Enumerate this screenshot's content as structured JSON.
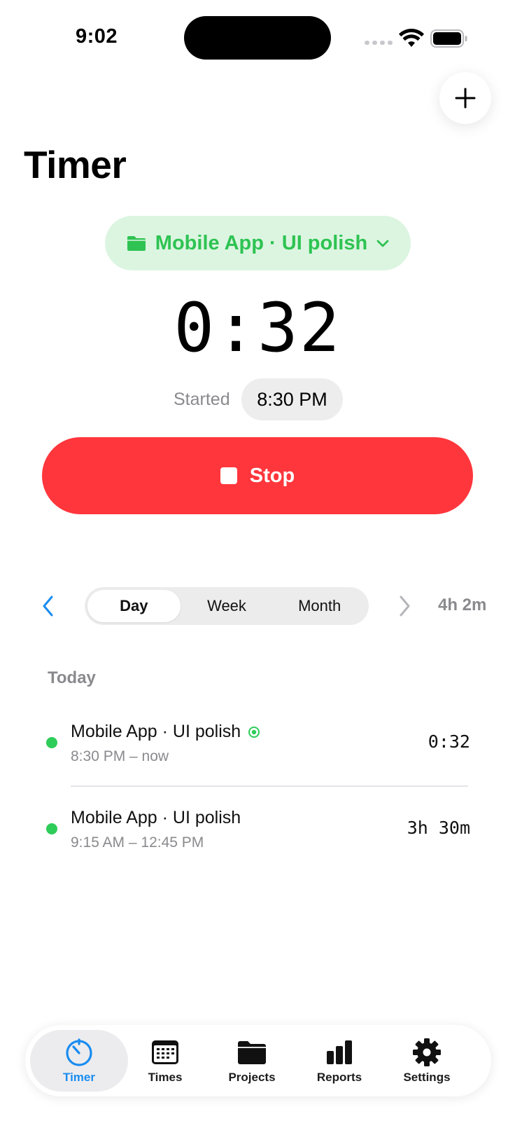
{
  "status_bar": {
    "time": "9:02"
  },
  "header": {
    "title": "Timer"
  },
  "timer": {
    "project_label": "Mobile App · UI polish",
    "elapsed": "0:32",
    "started_label": "Started",
    "started_time": "8:30 PM",
    "stop_label": "Stop"
  },
  "range": {
    "segments": [
      "Day",
      "Week",
      "Month"
    ],
    "selected": "Day",
    "total": "4h 2m"
  },
  "section": {
    "title": "Today"
  },
  "entries": [
    {
      "title": "Mobile App · UI polish",
      "range": "8:30 PM – now",
      "duration": "0:32",
      "running": true
    },
    {
      "title": "Mobile App · UI polish",
      "range": "9:15 AM – 12:45 PM",
      "duration": "3h 30m",
      "running": false
    }
  ],
  "tabbar": {
    "tabs": [
      {
        "label": "Timer",
        "icon": "timer-icon",
        "active": true
      },
      {
        "label": "Times",
        "icon": "calendar-icon",
        "active": false
      },
      {
        "label": "Projects",
        "icon": "folder-icon",
        "active": false
      },
      {
        "label": "Reports",
        "icon": "bar-chart-icon",
        "active": false
      },
      {
        "label": "Settings",
        "icon": "gear-icon",
        "active": false
      }
    ]
  },
  "colors": {
    "accent_green": "#2ec352",
    "pill_bg": "#dcf5e1",
    "stop_red": "#ff363c",
    "tab_active_blue": "#1a8cf0",
    "entry_dot": "#2ecc59"
  }
}
